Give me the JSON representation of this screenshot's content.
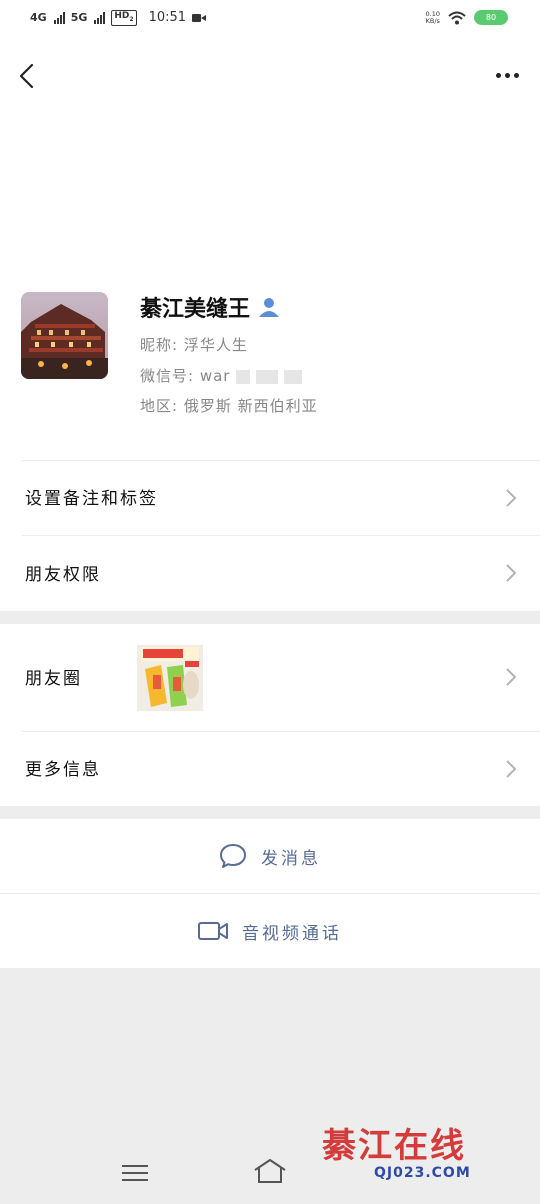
{
  "status_bar": {
    "network1": "4G",
    "network2": "5G",
    "hd": "HD",
    "hd_sub": "2",
    "time": "10:51",
    "speed_value": "0.10",
    "speed_unit": "KB/s",
    "battery": "80"
  },
  "profile": {
    "name": "綦江美缝王",
    "nickname": "昵称: 浮华人生",
    "wechat_id": "微信号: war",
    "region": "地区: 俄罗斯 新西伯利亚"
  },
  "menu": {
    "remarks_tags": "设置备注和标签",
    "friend_permissions": "朋友权限",
    "moments": "朋友圈",
    "more_info": "更多信息"
  },
  "actions": {
    "send_message": "发消息",
    "video_call": "音视频通话"
  },
  "watermark": {
    "title": "綦江在线",
    "url": "QJ023.COM"
  },
  "colors": {
    "link": "#576b95",
    "background": "#ededed",
    "battery": "#5bcb72"
  }
}
